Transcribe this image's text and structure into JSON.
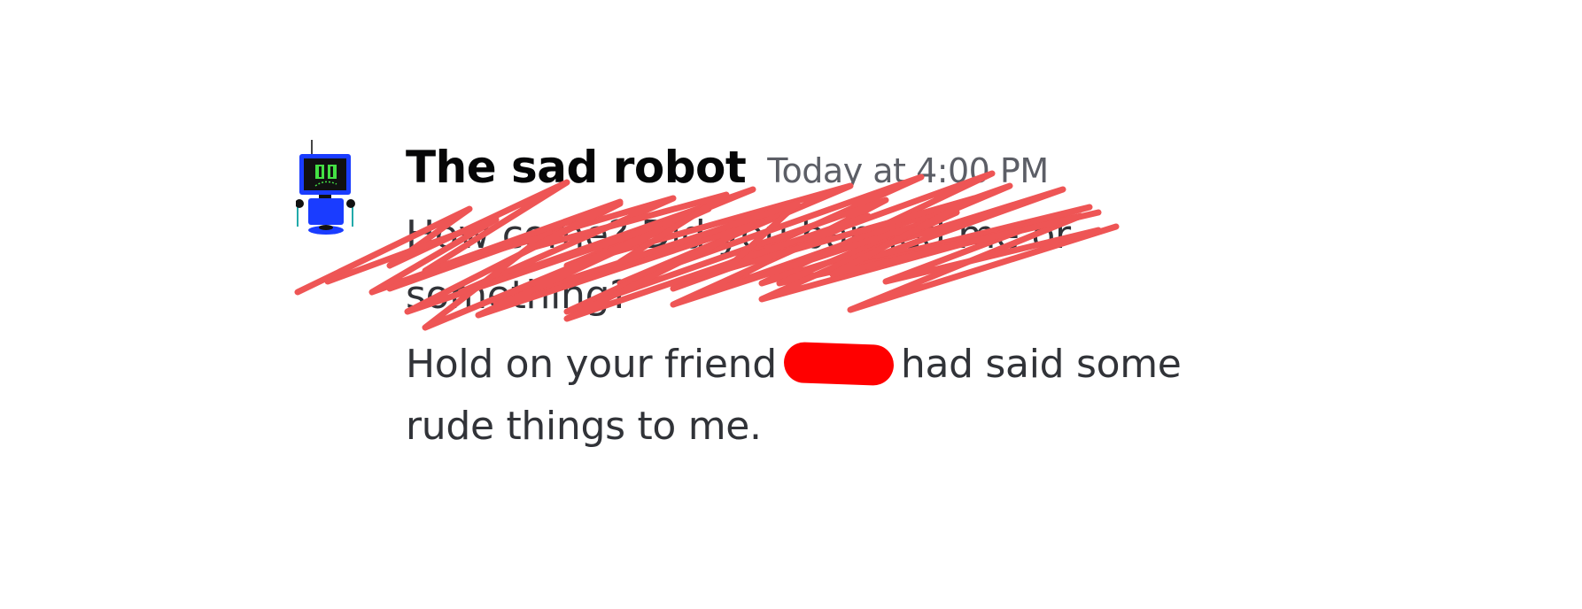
{
  "message": {
    "author": "The sad robot",
    "timestamp": "Today at 4:00 PM",
    "struck_line_1": "How come? Did you banned me or",
    "struck_line_2": "something?",
    "text_line_1_before": "Hold on your friend",
    "text_line_1_after": "had said some",
    "text_line_2": "rude things to me."
  },
  "colors": {
    "scribble": "#ee5555",
    "redaction": "#ff0000",
    "avatar_body": "#1a3cff",
    "avatar_screen": "#111111",
    "avatar_eyes": "#44e044"
  },
  "icons": {
    "avatar": "robot-avatar-icon"
  }
}
